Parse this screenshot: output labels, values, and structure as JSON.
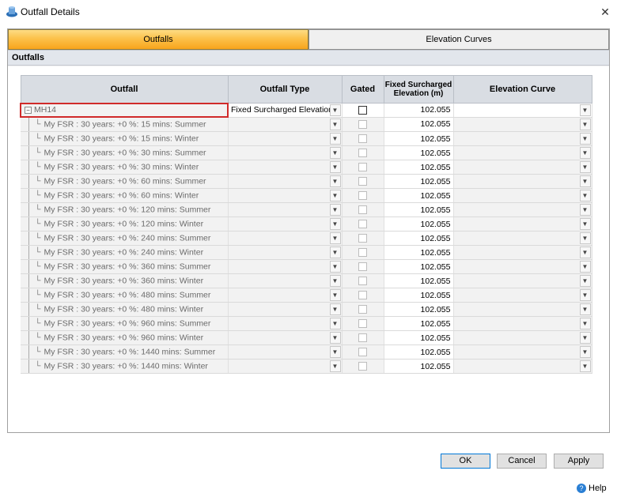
{
  "window": {
    "title": "Outfall Details",
    "icon": "app-icon",
    "close": "✕"
  },
  "tabs": [
    {
      "label": "Outfalls",
      "active": true
    },
    {
      "label": "Elevation Curves",
      "active": false
    }
  ],
  "section_title": "Outfalls",
  "grid": {
    "headers": [
      "Outfall",
      "Outfall Type",
      "Gated",
      "Fixed Surcharged Elevation (m)",
      "Elevation Curve"
    ],
    "parent": {
      "name": "MH14",
      "type": "Fixed Surcharged Elevation",
      "gated": false,
      "elevation": "102.055",
      "curve": ""
    },
    "rows": [
      {
        "name": "My FSR : 30 years: +0 %: 15 mins: Summer",
        "elevation": "102.055"
      },
      {
        "name": "My FSR : 30 years: +0 %: 15 mins: Winter",
        "elevation": "102.055"
      },
      {
        "name": "My FSR : 30 years: +0 %: 30 mins: Summer",
        "elevation": "102.055"
      },
      {
        "name": "My FSR : 30 years: +0 %: 30 mins: Winter",
        "elevation": "102.055"
      },
      {
        "name": "My FSR : 30 years: +0 %: 60 mins: Summer",
        "elevation": "102.055"
      },
      {
        "name": "My FSR : 30 years: +0 %: 60 mins: Winter",
        "elevation": "102.055"
      },
      {
        "name": "My FSR : 30 years: +0 %: 120 mins: Summer",
        "elevation": "102.055"
      },
      {
        "name": "My FSR : 30 years: +0 %: 120 mins: Winter",
        "elevation": "102.055"
      },
      {
        "name": "My FSR : 30 years: +0 %: 240 mins: Summer",
        "elevation": "102.055"
      },
      {
        "name": "My FSR : 30 years: +0 %: 240 mins: Winter",
        "elevation": "102.055"
      },
      {
        "name": "My FSR : 30 years: +0 %: 360 mins: Summer",
        "elevation": "102.055"
      },
      {
        "name": "My FSR : 30 years: +0 %: 360 mins: Winter",
        "elevation": "102.055"
      },
      {
        "name": "My FSR : 30 years: +0 %: 480 mins: Summer",
        "elevation": "102.055"
      },
      {
        "name": "My FSR : 30 years: +0 %: 480 mins: Winter",
        "elevation": "102.055"
      },
      {
        "name": "My FSR : 30 years: +0 %: 960 mins: Summer",
        "elevation": "102.055"
      },
      {
        "name": "My FSR : 30 years: +0 %: 960 mins: Winter",
        "elevation": "102.055"
      },
      {
        "name": "My FSR : 30 years: +0 %: 1440 mins: Summer",
        "elevation": "102.055"
      },
      {
        "name": "My FSR : 30 years: +0 %: 1440 mins: Winter",
        "elevation": "102.055"
      }
    ]
  },
  "buttons": {
    "ok": "OK",
    "cancel": "Cancel",
    "apply": "Apply"
  },
  "help": {
    "label": "Help",
    "icon_glyph": "?"
  },
  "colors": {
    "active_tab": "#fcc14a",
    "selection_border": "#d02a2a",
    "header_bg": "#d9dde3"
  }
}
